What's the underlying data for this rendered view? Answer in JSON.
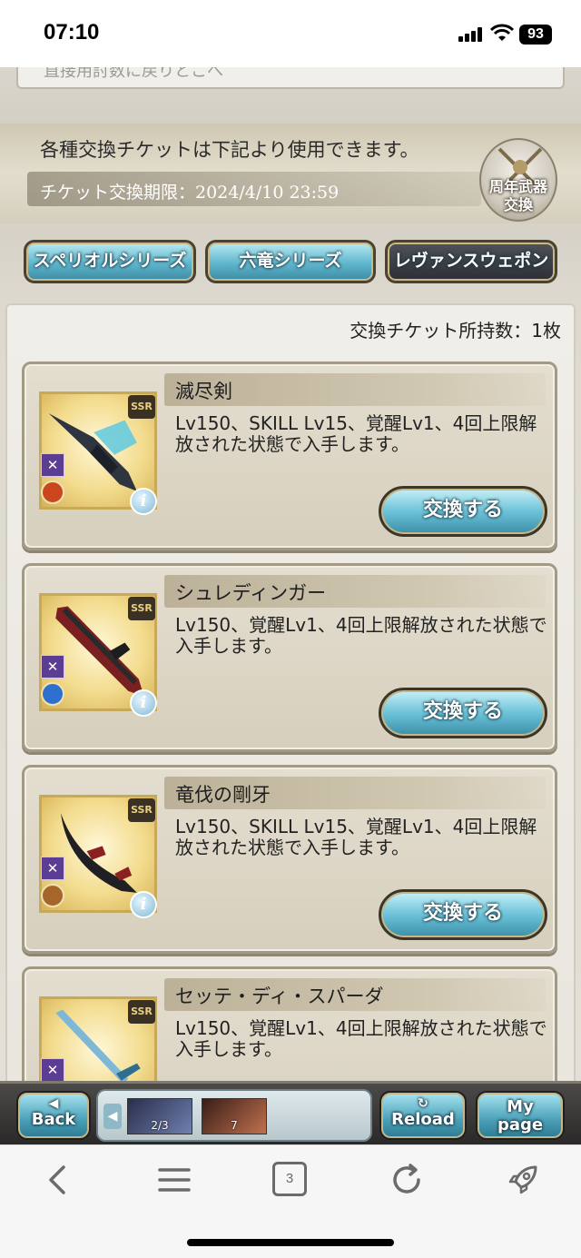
{
  "status_bar": {
    "time": "07:10",
    "battery": "93"
  },
  "header": {
    "truncated_text": "直接用討数に戻りとこへ",
    "info_line1": "各種交換チケットは下記より使用できます。",
    "info_line2": "チケット交換期限：2024/4/10 23:59",
    "emblem_line1": "周年武器",
    "emblem_line2": "交換"
  },
  "tabs": [
    {
      "label": "スペリオルシリーズ",
      "active": false
    },
    {
      "label": "六竜シリーズ",
      "active": false
    },
    {
      "label": "レヴァンスウェポン",
      "active": true
    }
  ],
  "ticket_count": "交換チケット所持数：1枚",
  "exchange_label": "交換する",
  "weapons": [
    {
      "name": "滅尽剣",
      "description": "Lv150、SKILL Lv15、覚醒Lv1、4回上限解放された状態で入手します。",
      "rarity": "SSR",
      "element_color": "#c9461f"
    },
    {
      "name": "シュレディンガー",
      "description": "Lv150、覚醒Lv1、4回上限解放された状態で入手します。",
      "rarity": "SSR",
      "element_color": "#2e6fd0"
    },
    {
      "name": "竜伐の剛牙",
      "description": "Lv150、SKILL Lv15、覚醒Lv1、4回上限解放された状態で入手します。",
      "rarity": "SSR",
      "element_color": "#a5652b"
    },
    {
      "name": "セッテ・ディ・スパーダ",
      "description": "Lv150、覚醒Lv1、4回上限解放された状態で入手します。",
      "rarity": "SSR",
      "element_color": "#3aa0a0"
    }
  ],
  "game_nav": {
    "back_label": "Back",
    "reload_label": "Reload",
    "mypage_line1": "My",
    "mypage_line2": "page",
    "tray_item1": "2/3",
    "tray_item2": "7"
  },
  "browser_bar": {
    "tab_count": "3"
  },
  "icons": {
    "back": "chevron-left-icon",
    "menu": "hamburger-menu-icon",
    "tabs": "tabs-icon",
    "reload": "reload-icon",
    "rocket": "rocket-icon"
  }
}
